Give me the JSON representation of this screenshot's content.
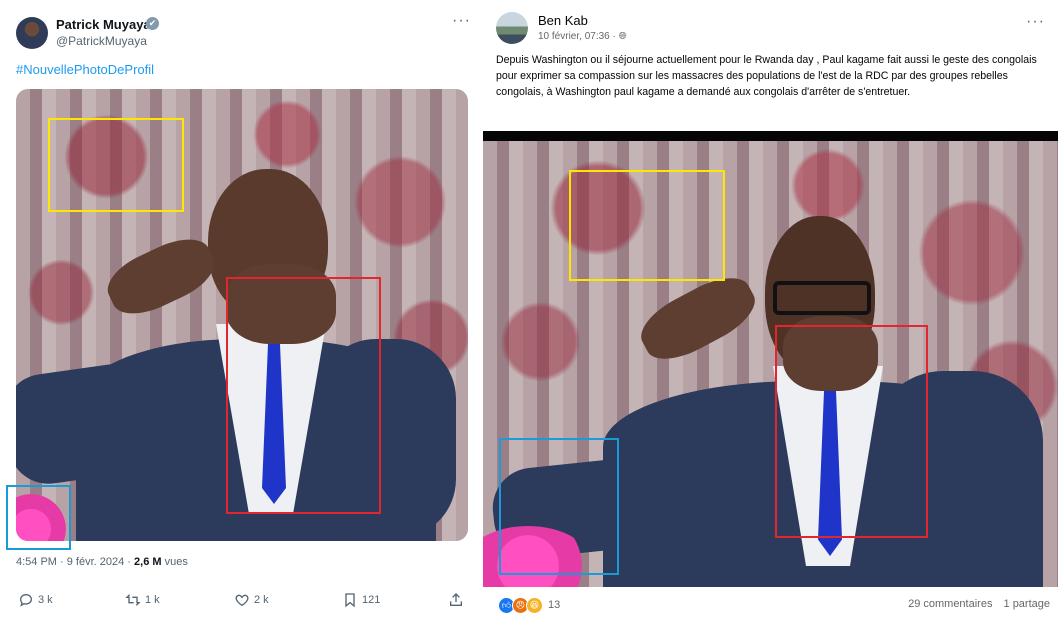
{
  "twitter_post": {
    "author_name": "Patrick Muyaya",
    "verified_mark": "✔",
    "handle": "@PatrickMuyaya",
    "more_label": "···",
    "hashtag": "#NouvellePhotoDeProfil",
    "timestamp": "4:54 PM · 9 févr. 2024 · ",
    "views_count": "2,6 M",
    "views_label": " vues",
    "actions": {
      "replies": "3 k",
      "reposts": "1 k",
      "likes": "2 k",
      "bookmarks": "121"
    },
    "icons": [
      "reply-icon",
      "repost-icon",
      "like-icon",
      "bookmark-icon",
      "share-icon"
    ]
  },
  "facebook_post": {
    "author_name": "Ben Kab",
    "date": "10 février, 07:36 · ",
    "privacy_icon": "globe-icon",
    "more_label": "···",
    "text": "Depuis Washington ou il séjourne actuellement pour le Rwanda day , Paul kagame fait aussi le geste des congolais pour exprimer sa compassion sur les massacres des populations de l'est de la RDC par des groupes rebelles congolais, à Washington paul kagame a demandé aux congolais d'arrêter de s'entretuer.",
    "reactions": {
      "icons": [
        "like-icon",
        "angry-icon",
        "laugh-icon"
      ],
      "count": "13"
    },
    "comments": "29 commentaires",
    "shares": "1 partage"
  },
  "annotation_colors": {
    "yellow": "#ffe600",
    "red": "#e3262e",
    "blue": "#1a9ad6"
  },
  "theme": {
    "twitter_link": "#1d9bf0",
    "twitter_muted": "#536471",
    "facebook_muted": "#65676b"
  }
}
